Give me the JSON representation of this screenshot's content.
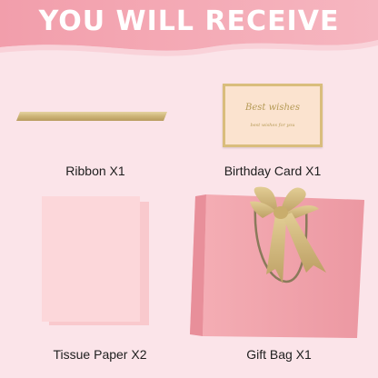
{
  "header": {
    "title": "YOU WILL RECEIVE"
  },
  "items": [
    {
      "label": "Ribbon X1",
      "icon": "ribbon-icon"
    },
    {
      "label": "Birthday Card X1",
      "icon": "card-icon",
      "card_text": [
        "Best wishes",
        "best wishes for you"
      ]
    },
    {
      "label": "Tissue Paper X2",
      "icon": "tissue-paper-icon"
    },
    {
      "label": "Gift Bag X1",
      "icon": "gift-bag-icon"
    }
  ],
  "colors": {
    "header_pink": "#f3a1ae",
    "background": "#fbe3e8",
    "gold": "#c9ad6c",
    "bag_pink": "#f0a0a9",
    "tissue_pink": "#fbd3d6"
  }
}
